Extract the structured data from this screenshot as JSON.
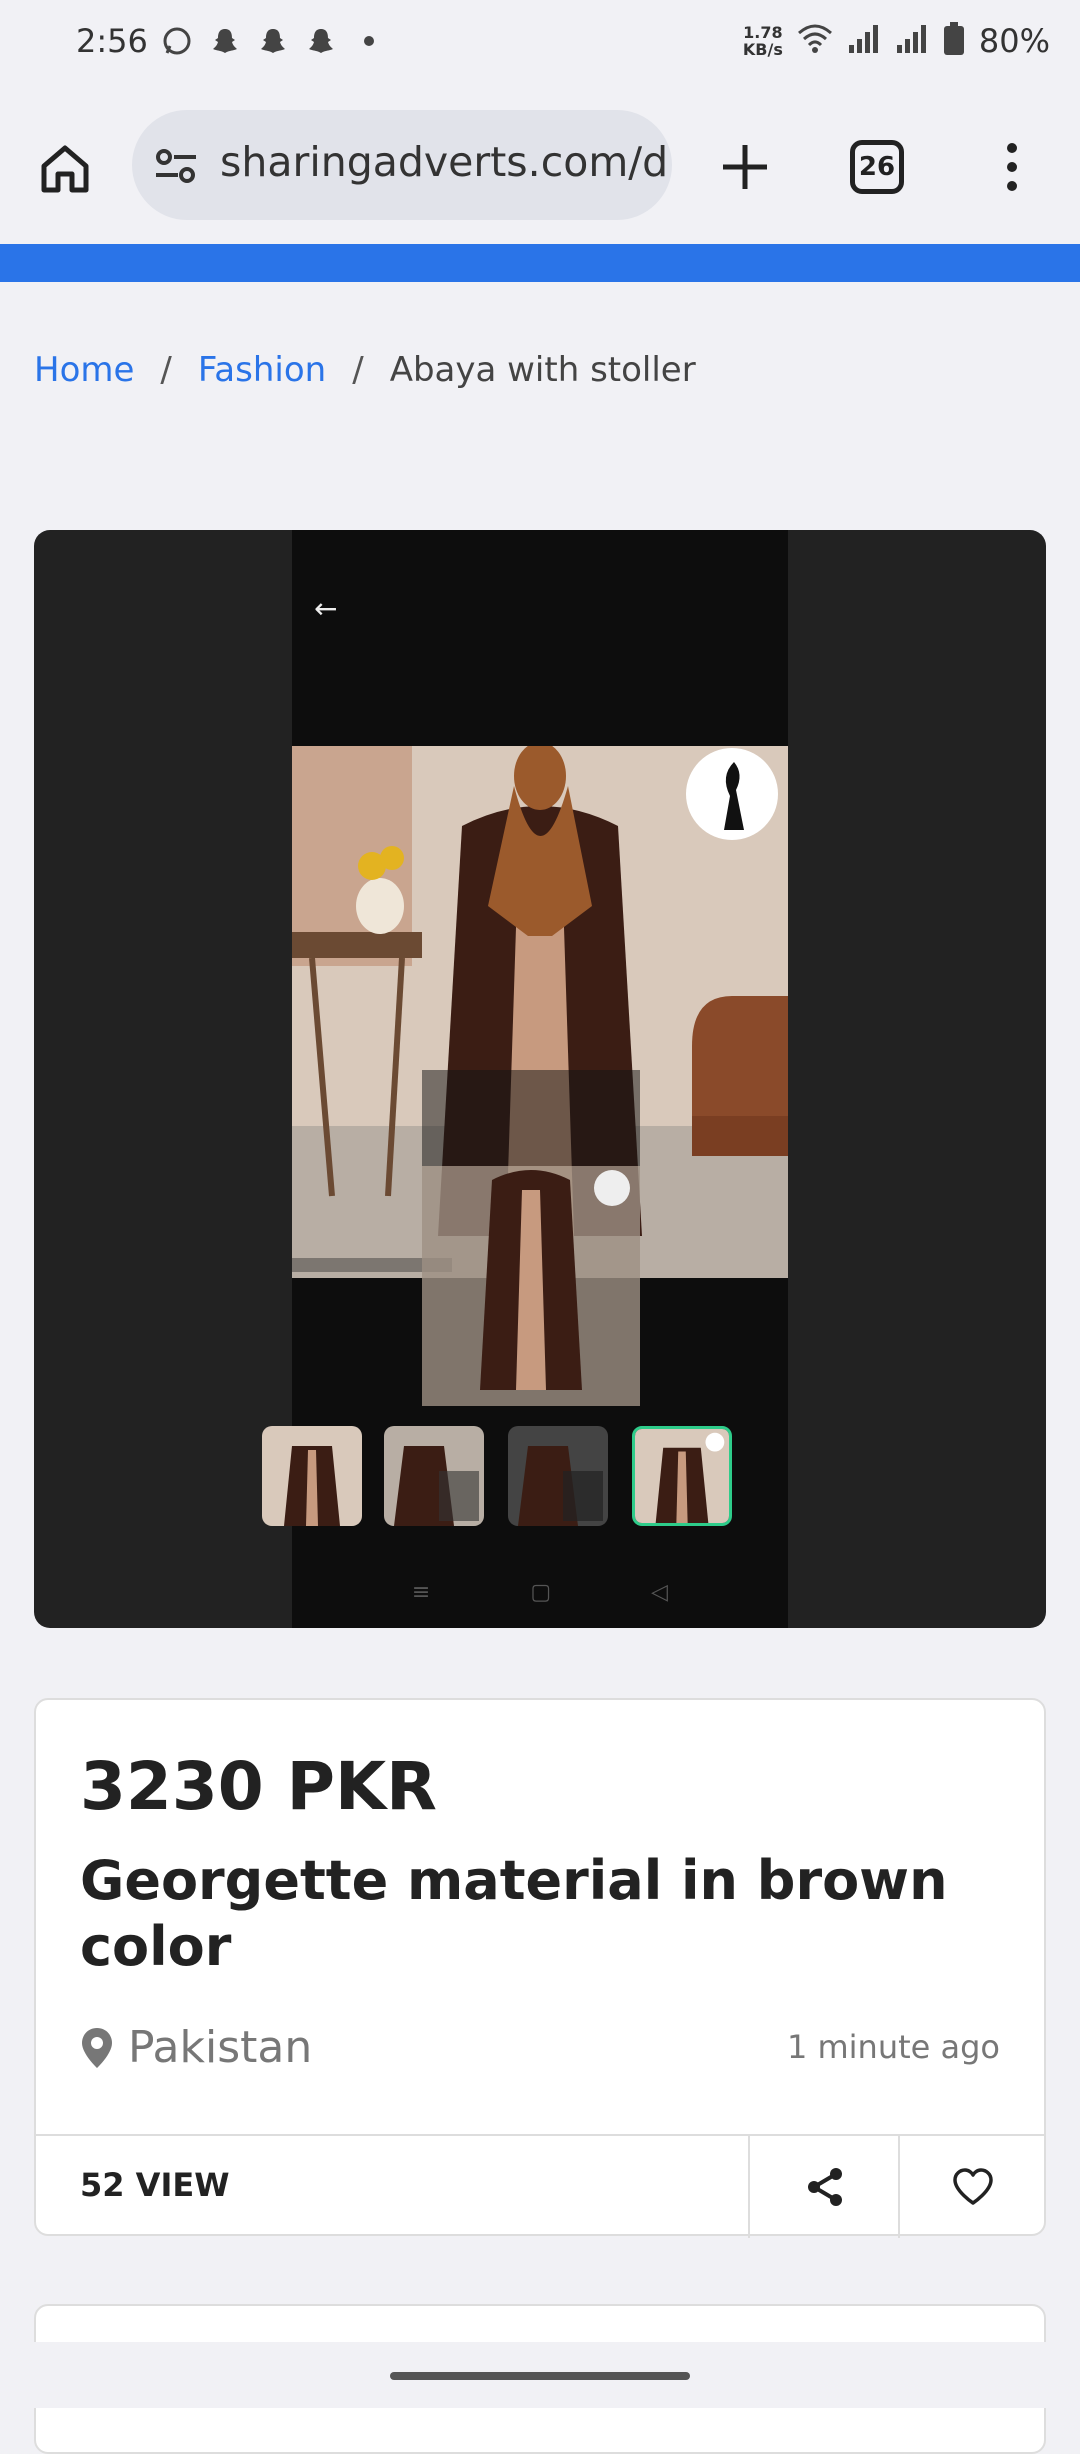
{
  "status_bar": {
    "time": "2:56",
    "net_speed_value": "1.78",
    "net_speed_unit": "KB/s",
    "battery": "80%"
  },
  "browser": {
    "url": "sharingadverts.com/d",
    "tab_count": "26"
  },
  "breadcrumb": {
    "home": "Home",
    "category": "Fashion",
    "current": "Abaya with stoller"
  },
  "listing": {
    "price": "3230 PKR",
    "title": "Georgette material in brown color",
    "location": "Pakistan",
    "posted": "1 minute ago",
    "views": "52 VIEW"
  },
  "colors": {
    "accent": "#2a74e8",
    "abaya_brown": "#3b1d14",
    "scarf": "#9b5a2c"
  }
}
